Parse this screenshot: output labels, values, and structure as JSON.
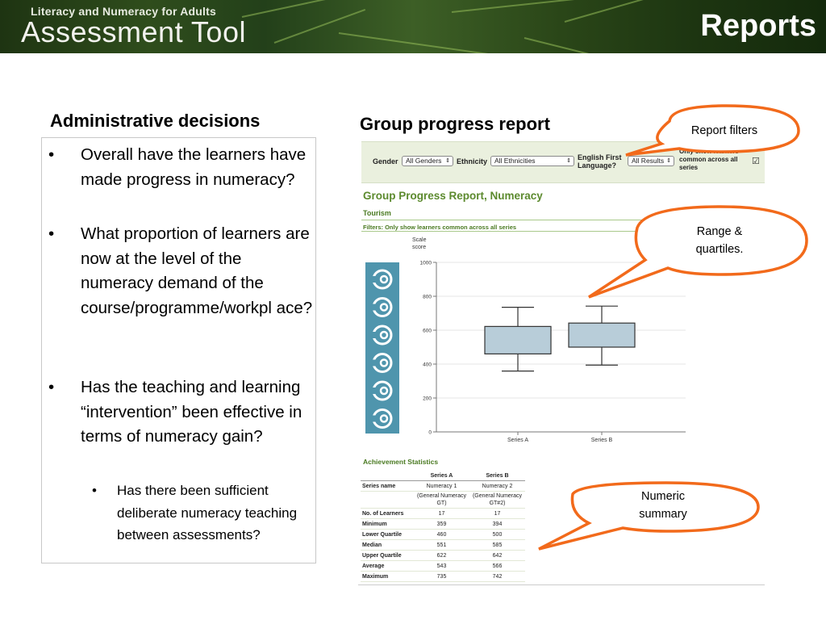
{
  "header": {
    "subtitle": "Literacy and Numeracy for Adults",
    "title": "Assessment Tool",
    "slide_title": "Reports"
  },
  "left": {
    "heading": "Administrative decisions",
    "bullets": [
      "Overall have the learners have made progress in numeracy?",
      "What proportion of learners are now at the level of the numeracy demand of the course/programme/workpl ace?",
      "Has the teaching and learning “intervention” been effective in terms of numeracy gain?"
    ],
    "sub_bullet": "Has there been sufficient deliberate numeracy teaching between assessments?"
  },
  "right": {
    "heading": "Group progress report"
  },
  "filters": {
    "gender_label": "Gender",
    "gender_value": "All Genders",
    "ethnicity_label": "Ethnicity",
    "ethnicity_value": "All Ethnicities",
    "language_label": "English First Language?",
    "language_value": "All Results",
    "common_label": "Only show learners common across all series",
    "common_checked": true
  },
  "report": {
    "title": "Group Progress Report, Numeracy",
    "subtitle": "Tourism",
    "filters_note": "Filters: Only show learners common across all series"
  },
  "chart_data": {
    "type": "boxplot",
    "ylabel": "Scale score",
    "ylim": [
      0,
      1000
    ],
    "yticks": [
      0,
      200,
      400,
      600,
      800,
      1000
    ],
    "categories": [
      "Series A",
      "Series B"
    ],
    "series": [
      {
        "name": "Series A",
        "min": 359,
        "q1": 460,
        "q3": 622,
        "max": 735
      },
      {
        "name": "Series B",
        "min": 394,
        "q1": 500,
        "q3": 642,
        "max": 742
      }
    ],
    "box_color": "#b8cdd9",
    "grid": true
  },
  "stats": {
    "title": "Achievement Statistics",
    "columns": [
      "",
      "Series A",
      "Series B"
    ],
    "rows": [
      [
        "Series name",
        "Numeracy 1",
        "Numeracy 2"
      ],
      [
        "",
        "(General Numeracy GT)",
        "(General Numeracy GT#2)"
      ],
      [
        "No. of Learners",
        "17",
        "17"
      ],
      [
        "Minimum",
        "359",
        "394"
      ],
      [
        "Lower Quartile",
        "460",
        "500"
      ],
      [
        "Median",
        "551",
        "585"
      ],
      [
        "Upper Quartile",
        "622",
        "642"
      ],
      [
        "Average",
        "543",
        "566"
      ],
      [
        "Maximum",
        "735",
        "742"
      ]
    ]
  },
  "callouts": {
    "filters": "Report filters",
    "range_1": "Range &",
    "range_2": "quartiles.",
    "numeric_1": "Numeric",
    "numeric_2": "summary"
  },
  "colors": {
    "accent_green": "#5c8a2e",
    "callout_orange": "#f26a1b",
    "icon_panel": "#4f95ad"
  }
}
